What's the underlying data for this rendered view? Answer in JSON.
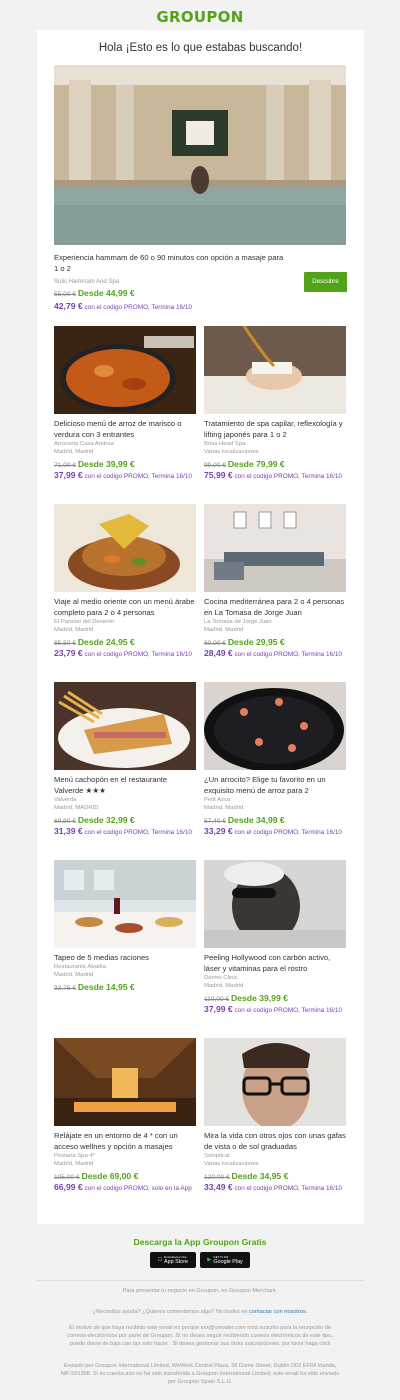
{
  "logo": "GROUPON",
  "greeting": "Hola ¡Esto es lo que estabas buscando!",
  "hero": {
    "title": "Experiencia hammam de 60 o 90 minutos con opción a masaje para 1 o 2",
    "merchant": "Sulis Hammam And Spa",
    "old_price": "55,00 €",
    "price": "Desde 44,99 €",
    "promo_price": "42,79 €",
    "promo_text": "con el codigo PROMO, Termina 16/10",
    "button": "Descubre"
  },
  "deals": [
    {
      "title": "Delicioso menú de arroz de marisco o verdura con 3 entrantes",
      "merchant": "Arrocería Casa Andrea",
      "location": "Madrid, Madrid",
      "old_price": "71,00 €",
      "price": "Desde 39,99 €",
      "promo_price": "37,99 €",
      "promo_text": "con el codigo PROMO, Termina 16/10"
    },
    {
      "title": "Tratamiento de spa capilar, reflexología y lifting japonés para 1 o 2",
      "merchant": "Brisa Head Spa",
      "location": "Varias localizaciones",
      "old_price": "99,00 €",
      "price": "Desde 79,99 €",
      "promo_price": "75,99 €",
      "promo_text": "con el codigo PROMO, Termina 16/10"
    },
    {
      "title": "Viaje al medio oriente con un menú árabe completo para 2 o 4 personas",
      "merchant": "El Paraíso del Desierto",
      "location": "Madrid, Madrid",
      "old_price": "65,50 €",
      "price": "Desde 24,95 €",
      "promo_price": "23,79 €",
      "promo_text": "con el codigo PROMO, Termina 16/10"
    },
    {
      "title": "Cocina mediterránea para 2 o 4 personas en La Tomasa de Jorge Juan",
      "merchant": "La Tomasa de Jorge Juan",
      "location": "Madrid, Madrid",
      "old_price": "60,00 €",
      "price": "Desde 29,95 €",
      "promo_price": "28,49 €",
      "promo_text": "con el codigo PROMO, Termina 16/10"
    },
    {
      "title": "Menú cachopón en el restaurante Valverde ★★★",
      "merchant": "Valverde",
      "location": "Madrid, MADRID",
      "old_price": "69,90 €",
      "price": "Desde 32,99 €",
      "promo_price": "31,39 €",
      "promo_text": "con el codigo PROMO, Termina 16/10"
    },
    {
      "title": "¿Un arrocito? Elige tu favorito en un exquisito menú de arroz para 2",
      "merchant": "Petit Azca",
      "location": "Madrid, Madrid",
      "old_price": "57,40 €",
      "price": "Desde 34,99 €",
      "promo_price": "33,29 €",
      "promo_text": "con el codigo PROMO, Termina 16/10"
    },
    {
      "title": "Tapeo de 5 medias raciones",
      "merchant": "Restaurante Abadía",
      "location": "Madrid, Madrid",
      "old_price": "33,75 €",
      "price": "Desde 14,95 €",
      "promo_price": "",
      "promo_text": ""
    },
    {
      "title": "Peeling Hollywood con carbón activo, láser y vitaminas para el rostro",
      "merchant": "Dermo Clinic",
      "location": "Madrid, Madrid",
      "old_price": "110,00 €",
      "price": "Desde 39,99 €",
      "promo_price": "37,99 €",
      "promo_text": "con el codigo PROMO, Termina 16/10"
    },
    {
      "title": "Relájate en un entorno de 4 * con un acceso wellnes y opción a masajes",
      "merchant": "Pestana Spa 4*",
      "location": "Madrid, Madrid",
      "old_price": "105,00 €",
      "price": "Desde 69,00 €",
      "promo_price": "66,99 €",
      "promo_text": "con el codigo PROMO, solo en la App"
    },
    {
      "title": "Mira la vida con otros ojos con unas gafas de vista o de sol graduadas",
      "merchant": "Soloptical",
      "location": "Varias localizaciones",
      "old_price": "120,00 €",
      "price": "Desde 34,95 €",
      "promo_price": "33,49 €",
      "promo_text": "con el codigo PROMO, Termina 16/10"
    }
  ],
  "download": "Descarga la App Groupon Gratis",
  "stores": {
    "apple_small": "Download on the",
    "apple": "App Store",
    "google_small": "GET IT ON",
    "google": "Google Play"
  },
  "footer": {
    "merchant": "Para presentar tu negocio en Groupon, en Groupon Merchant.",
    "help": "¿Necesitas ayuda? ¿Quieres comentarnos algo? No dudes en",
    "help_link": "contactar con nosotros.",
    "reason": "El motivo de que haya recibido este email es porque xxx@ureader.com está suscrito para la recepción de correos electrónicos por parte de Groupon. Si no desea seguir recibiendo correos electrónicos de este tipo, puede darse de baja con tan solo hacer . Si desea gestionar sus otras suscripciones, por favor haga click",
    "sender": "Enviado por Groupon International Limited, WeWork Central Plaza, 36 Dame Street, Dublin D02 EF64 Irlanda, NIF:501358. Si su cuenta aún no ha sido transferida a Groupon International Limited, este email ha sido enviado por Groupon Spain S.L.U."
  },
  "colors": {
    "brand": "#53a318",
    "promo": "#7a3fb5",
    "link": "#2a7ab8"
  }
}
